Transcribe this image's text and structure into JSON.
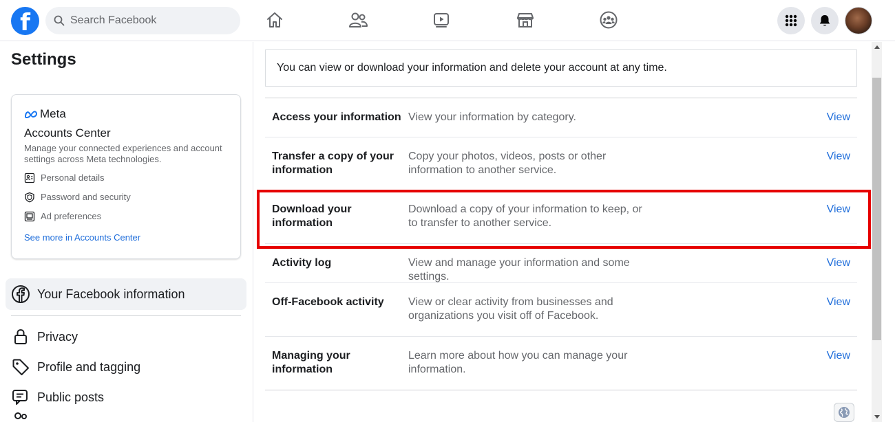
{
  "header": {
    "logo_letter": "f",
    "search_placeholder": "Search Facebook",
    "nav_icons": [
      "home-icon",
      "friends-icon",
      "watch-icon",
      "marketplace-icon",
      "groups-icon"
    ],
    "right_icons": [
      "menu-grid-icon",
      "notifications-bell-icon",
      "profile-avatar"
    ]
  },
  "sidebar": {
    "title": "Settings",
    "accounts_center": {
      "brand": "Meta",
      "title": "Accounts Center",
      "description": "Manage your connected experiences and account settings across Meta technologies.",
      "items": [
        {
          "label": "Personal details",
          "icon": "id-card-icon"
        },
        {
          "label": "Password and security",
          "icon": "shield-icon"
        },
        {
          "label": "Ad preferences",
          "icon": "monitor-icon"
        }
      ],
      "link": "See more in Accounts Center"
    },
    "active_item": {
      "label": "Your Facebook information",
      "icon": "facebook-circle-icon"
    },
    "items": [
      {
        "label": "Privacy",
        "icon": "lock-icon"
      },
      {
        "label": "Profile and tagging",
        "icon": "tag-icon"
      },
      {
        "label": "Public posts",
        "icon": "chat-bubble-icon"
      }
    ]
  },
  "main": {
    "intro": "You can view or download your information and delete your account at any time.",
    "rows": [
      {
        "title": "Access your information",
        "description": "View your information by category.",
        "action": "View"
      },
      {
        "title": "Transfer a copy of your information",
        "description": "Copy your photos, videos, posts or other information to another service.",
        "action": "View"
      },
      {
        "title": "Download your information",
        "description": "Download a copy of your information to keep, or to transfer to another service.",
        "action": "View"
      },
      {
        "title": "Activity log",
        "description": "View and manage your information and some settings.",
        "action": "View"
      },
      {
        "title": "Off-Facebook activity",
        "description": "View or clear activity from businesses and organizations you visit off of Facebook.",
        "action": "View"
      },
      {
        "title": "Managing your information",
        "description": "Learn more about how you can manage your information.",
        "action": "View"
      }
    ],
    "highlighted_row": "Download your information"
  },
  "colors": {
    "brand_blue": "#1877f2",
    "link_blue": "#216fdb",
    "highlight_red": "#e60000"
  }
}
